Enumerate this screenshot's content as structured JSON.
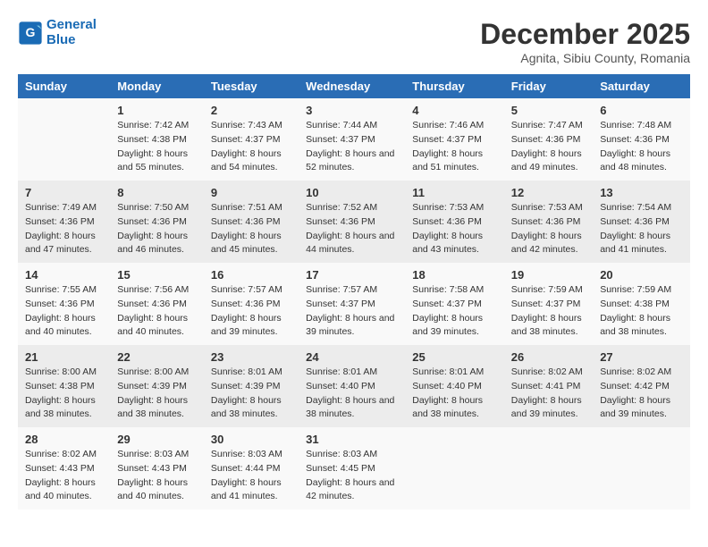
{
  "logo": {
    "line1": "General",
    "line2": "Blue"
  },
  "title": "December 2025",
  "subtitle": "Agnita, Sibiu County, Romania",
  "days_header": [
    "Sunday",
    "Monday",
    "Tuesday",
    "Wednesday",
    "Thursday",
    "Friday",
    "Saturday"
  ],
  "weeks": [
    [
      {
        "day": "",
        "sunrise": "",
        "sunset": "",
        "daylight": ""
      },
      {
        "day": "1",
        "sunrise": "Sunrise: 7:42 AM",
        "sunset": "Sunset: 4:38 PM",
        "daylight": "Daylight: 8 hours and 55 minutes."
      },
      {
        "day": "2",
        "sunrise": "Sunrise: 7:43 AM",
        "sunset": "Sunset: 4:37 PM",
        "daylight": "Daylight: 8 hours and 54 minutes."
      },
      {
        "day": "3",
        "sunrise": "Sunrise: 7:44 AM",
        "sunset": "Sunset: 4:37 PM",
        "daylight": "Daylight: 8 hours and 52 minutes."
      },
      {
        "day": "4",
        "sunrise": "Sunrise: 7:46 AM",
        "sunset": "Sunset: 4:37 PM",
        "daylight": "Daylight: 8 hours and 51 minutes."
      },
      {
        "day": "5",
        "sunrise": "Sunrise: 7:47 AM",
        "sunset": "Sunset: 4:36 PM",
        "daylight": "Daylight: 8 hours and 49 minutes."
      },
      {
        "day": "6",
        "sunrise": "Sunrise: 7:48 AM",
        "sunset": "Sunset: 4:36 PM",
        "daylight": "Daylight: 8 hours and 48 minutes."
      }
    ],
    [
      {
        "day": "7",
        "sunrise": "Sunrise: 7:49 AM",
        "sunset": "Sunset: 4:36 PM",
        "daylight": "Daylight: 8 hours and 47 minutes."
      },
      {
        "day": "8",
        "sunrise": "Sunrise: 7:50 AM",
        "sunset": "Sunset: 4:36 PM",
        "daylight": "Daylight: 8 hours and 46 minutes."
      },
      {
        "day": "9",
        "sunrise": "Sunrise: 7:51 AM",
        "sunset": "Sunset: 4:36 PM",
        "daylight": "Daylight: 8 hours and 45 minutes."
      },
      {
        "day": "10",
        "sunrise": "Sunrise: 7:52 AM",
        "sunset": "Sunset: 4:36 PM",
        "daylight": "Daylight: 8 hours and 44 minutes."
      },
      {
        "day": "11",
        "sunrise": "Sunrise: 7:53 AM",
        "sunset": "Sunset: 4:36 PM",
        "daylight": "Daylight: 8 hours and 43 minutes."
      },
      {
        "day": "12",
        "sunrise": "Sunrise: 7:53 AM",
        "sunset": "Sunset: 4:36 PM",
        "daylight": "Daylight: 8 hours and 42 minutes."
      },
      {
        "day": "13",
        "sunrise": "Sunrise: 7:54 AM",
        "sunset": "Sunset: 4:36 PM",
        "daylight": "Daylight: 8 hours and 41 minutes."
      }
    ],
    [
      {
        "day": "14",
        "sunrise": "Sunrise: 7:55 AM",
        "sunset": "Sunset: 4:36 PM",
        "daylight": "Daylight: 8 hours and 40 minutes."
      },
      {
        "day": "15",
        "sunrise": "Sunrise: 7:56 AM",
        "sunset": "Sunset: 4:36 PM",
        "daylight": "Daylight: 8 hours and 40 minutes."
      },
      {
        "day": "16",
        "sunrise": "Sunrise: 7:57 AM",
        "sunset": "Sunset: 4:36 PM",
        "daylight": "Daylight: 8 hours and 39 minutes."
      },
      {
        "day": "17",
        "sunrise": "Sunrise: 7:57 AM",
        "sunset": "Sunset: 4:37 PM",
        "daylight": "Daylight: 8 hours and 39 minutes."
      },
      {
        "day": "18",
        "sunrise": "Sunrise: 7:58 AM",
        "sunset": "Sunset: 4:37 PM",
        "daylight": "Daylight: 8 hours and 39 minutes."
      },
      {
        "day": "19",
        "sunrise": "Sunrise: 7:59 AM",
        "sunset": "Sunset: 4:37 PM",
        "daylight": "Daylight: 8 hours and 38 minutes."
      },
      {
        "day": "20",
        "sunrise": "Sunrise: 7:59 AM",
        "sunset": "Sunset: 4:38 PM",
        "daylight": "Daylight: 8 hours and 38 minutes."
      }
    ],
    [
      {
        "day": "21",
        "sunrise": "Sunrise: 8:00 AM",
        "sunset": "Sunset: 4:38 PM",
        "daylight": "Daylight: 8 hours and 38 minutes."
      },
      {
        "day": "22",
        "sunrise": "Sunrise: 8:00 AM",
        "sunset": "Sunset: 4:39 PM",
        "daylight": "Daylight: 8 hours and 38 minutes."
      },
      {
        "day": "23",
        "sunrise": "Sunrise: 8:01 AM",
        "sunset": "Sunset: 4:39 PM",
        "daylight": "Daylight: 8 hours and 38 minutes."
      },
      {
        "day": "24",
        "sunrise": "Sunrise: 8:01 AM",
        "sunset": "Sunset: 4:40 PM",
        "daylight": "Daylight: 8 hours and 38 minutes."
      },
      {
        "day": "25",
        "sunrise": "Sunrise: 8:01 AM",
        "sunset": "Sunset: 4:40 PM",
        "daylight": "Daylight: 8 hours and 38 minutes."
      },
      {
        "day": "26",
        "sunrise": "Sunrise: 8:02 AM",
        "sunset": "Sunset: 4:41 PM",
        "daylight": "Daylight: 8 hours and 39 minutes."
      },
      {
        "day": "27",
        "sunrise": "Sunrise: 8:02 AM",
        "sunset": "Sunset: 4:42 PM",
        "daylight": "Daylight: 8 hours and 39 minutes."
      }
    ],
    [
      {
        "day": "28",
        "sunrise": "Sunrise: 8:02 AM",
        "sunset": "Sunset: 4:43 PM",
        "daylight": "Daylight: 8 hours and 40 minutes."
      },
      {
        "day": "29",
        "sunrise": "Sunrise: 8:03 AM",
        "sunset": "Sunset: 4:43 PM",
        "daylight": "Daylight: 8 hours and 40 minutes."
      },
      {
        "day": "30",
        "sunrise": "Sunrise: 8:03 AM",
        "sunset": "Sunset: 4:44 PM",
        "daylight": "Daylight: 8 hours and 41 minutes."
      },
      {
        "day": "31",
        "sunrise": "Sunrise: 8:03 AM",
        "sunset": "Sunset: 4:45 PM",
        "daylight": "Daylight: 8 hours and 42 minutes."
      },
      {
        "day": "",
        "sunrise": "",
        "sunset": "",
        "daylight": ""
      },
      {
        "day": "",
        "sunrise": "",
        "sunset": "",
        "daylight": ""
      },
      {
        "day": "",
        "sunrise": "",
        "sunset": "",
        "daylight": ""
      }
    ]
  ]
}
